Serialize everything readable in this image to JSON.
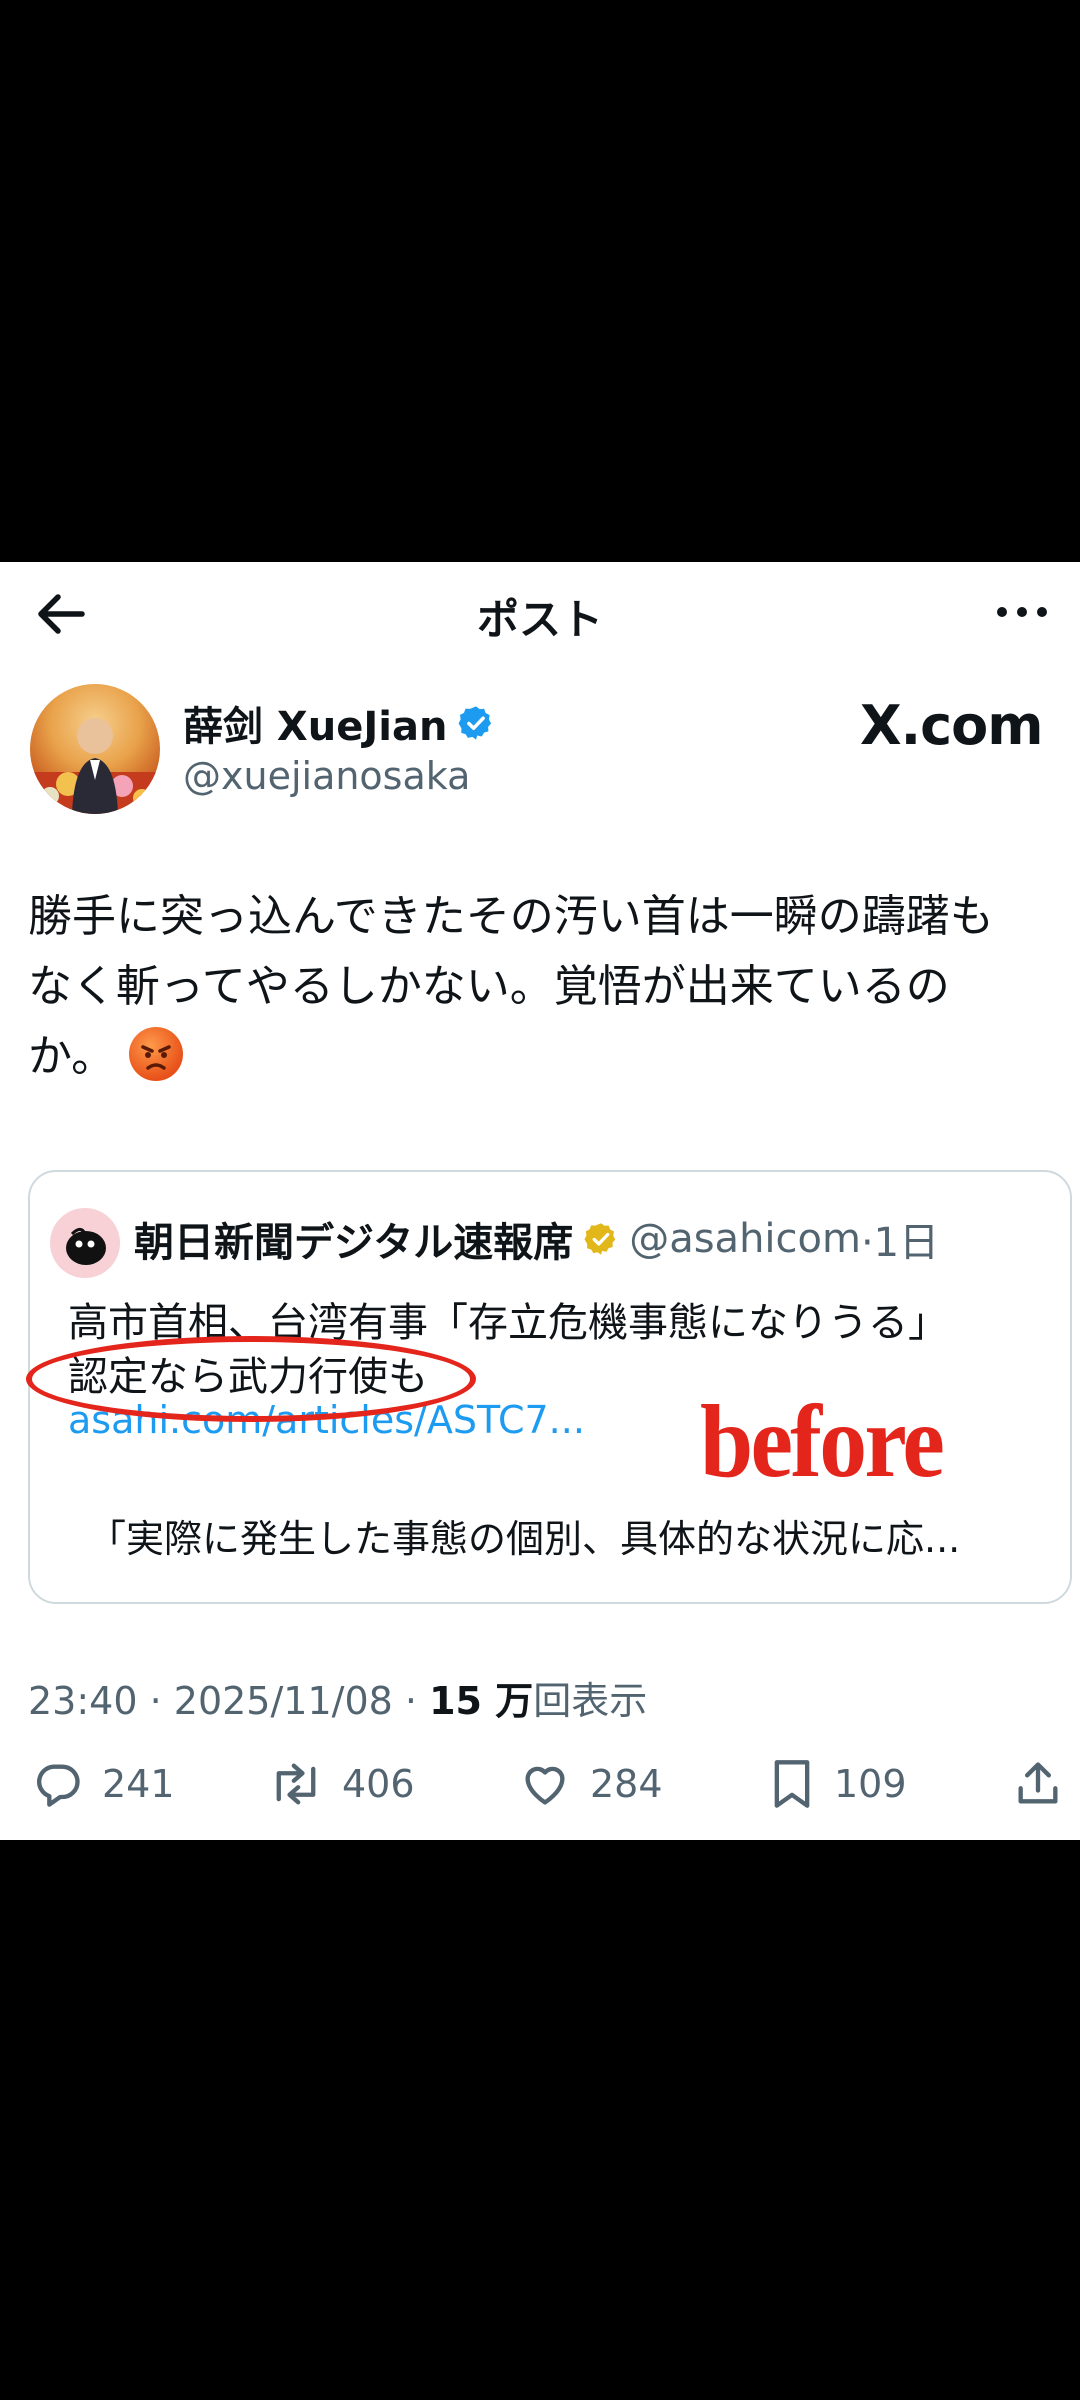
{
  "header": {
    "title": "ポスト"
  },
  "author": {
    "name": "薛剑 XueJian",
    "handle": "@xuejianosaka",
    "verified": true
  },
  "watermark": "X.com",
  "post": {
    "lines": [
      "勝手に突っ込んできたその汚い首は一瞬の躊躇も",
      "なく斬ってやるしかない。覚悟が出来ているの",
      "か。"
    ],
    "emoji": "angry-face-emoji"
  },
  "quote": {
    "name": "朝日新聞デジタル速報席",
    "handle": "@asahicom",
    "time": "·1日",
    "line1": "高市首相、台湾有事「存立危機事態になりうる」",
    "line2": "認定なら武力行使も",
    "link": "asahi.com/articles/ASTC7...",
    "snippet": "「実際に発生した事態の個別、具体的な状況に応..."
  },
  "annotation": {
    "label": "before",
    "color": "#e4251b"
  },
  "meta": {
    "time": "23:40",
    "date": "2025/11/08",
    "views_num": "15 万",
    "views_label": "回表示"
  },
  "actions": {
    "replies": "241",
    "reposts": "406",
    "likes": "284",
    "bookmarks": "109"
  },
  "colors": {
    "verified": "#1d9bf0",
    "gold": "#e2b719",
    "text": "#0f1419",
    "secondary": "#536471"
  }
}
